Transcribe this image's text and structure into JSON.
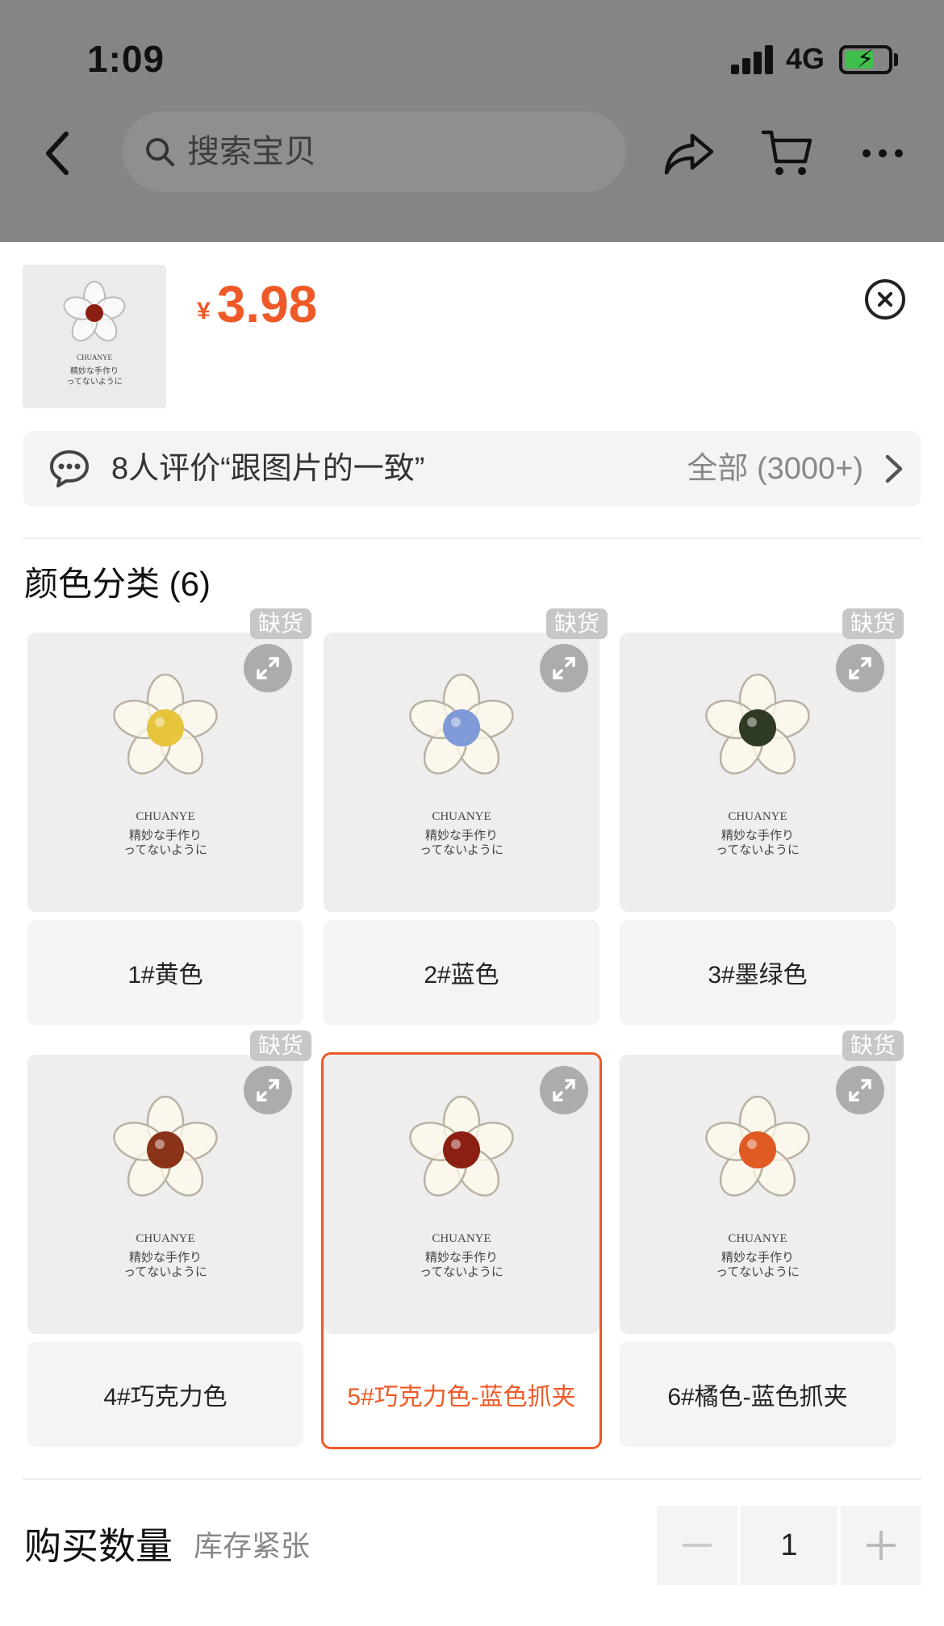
{
  "status_bar": {
    "time": "1:09",
    "network": "4G"
  },
  "nav": {
    "search_placeholder": "搜索宝贝"
  },
  "product": {
    "currency": "¥",
    "price": "3.98",
    "thumb_brand": "CHUANYE",
    "thumb_line1": "精妙な手作り",
    "thumb_line2": "ってないように"
  },
  "review": {
    "summary": "8人评价“跟图片的一致”",
    "all_label": "全部 (3000+)"
  },
  "variants": {
    "title": "颜色分类 (6)",
    "out_of_stock_label": "缺货",
    "image_brand": "CHUANYE",
    "image_line1": "精妙な手作り",
    "image_line2": "ってないように",
    "items": [
      {
        "label": "1#黄色",
        "bead_color": "#e6c43c",
        "out_of_stock": true,
        "selected": false
      },
      {
        "label": "2#蓝色",
        "bead_color": "#7f9ad6",
        "out_of_stock": true,
        "selected": false
      },
      {
        "label": "3#墨绿色",
        "bead_color": "#2f3a24",
        "out_of_stock": true,
        "selected": false
      },
      {
        "label": "4#巧克力色",
        "bead_color": "#8a3318",
        "out_of_stock": true,
        "selected": false
      },
      {
        "label": "5#巧克力色-蓝色抓夹",
        "bead_color": "#8c1f14",
        "out_of_stock": false,
        "selected": true
      },
      {
        "label": "6#橘色-蓝色抓夹",
        "bead_color": "#e05a23",
        "out_of_stock": true,
        "selected": false
      }
    ]
  },
  "quantity": {
    "label": "购买数量",
    "stock_note": "库存紧张",
    "value": "1"
  },
  "colors": {
    "accent": "#ee5a27",
    "overlay": "#858585"
  }
}
